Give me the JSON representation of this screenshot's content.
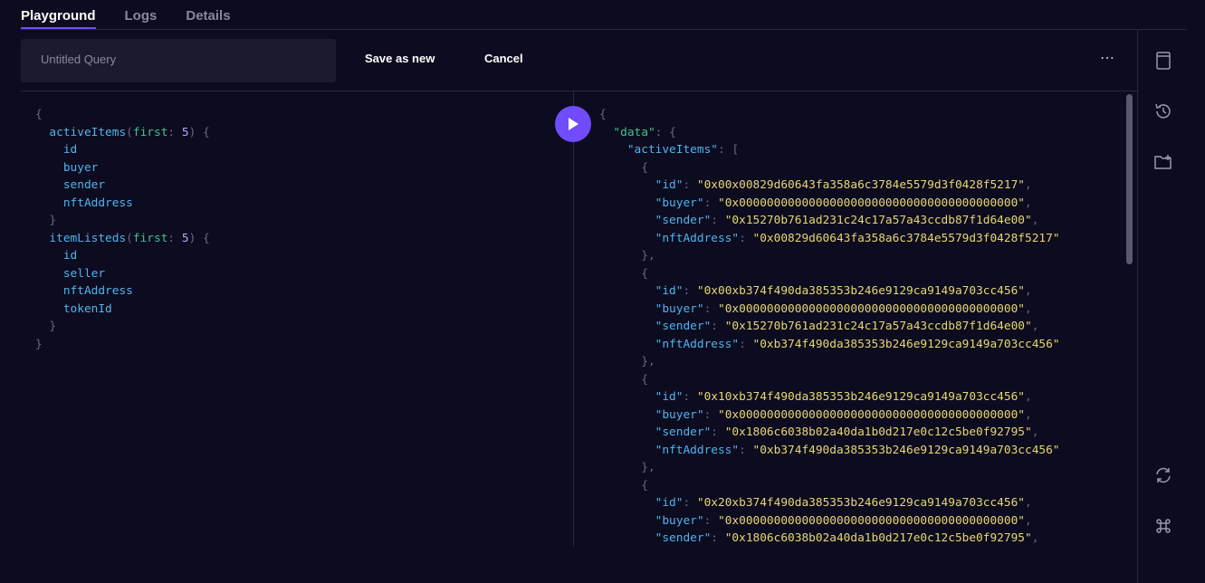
{
  "tabs": [
    {
      "label": "Playground"
    },
    {
      "label": "Logs"
    },
    {
      "label": "Details"
    }
  ],
  "toolbar": {
    "query_placeholder": "Untitled Query",
    "save_label": "Save as new",
    "cancel_label": "Cancel",
    "more_label": "⋯"
  },
  "query": {
    "open_brace": "{",
    "close_brace": "}",
    "entities": [
      {
        "name": "activeItems",
        "arg_name": "first",
        "arg_value": "5",
        "fields": [
          "id",
          "buyer",
          "sender",
          "nftAddress"
        ]
      },
      {
        "name": "itemListeds",
        "arg_name": "first",
        "arg_value": "5",
        "fields": [
          "id",
          "seller",
          "nftAddress",
          "tokenId"
        ]
      }
    ]
  },
  "result": {
    "data_key": "\"data\"",
    "collection_key": "\"activeItems\"",
    "items": [
      {
        "id": "0x00x00829d60643fa358a6c3784e5579d3f0428f5217",
        "buyer": "0x0000000000000000000000000000000000000000",
        "sender": "0x15270b761ad231c24c17a57a43ccdb87f1d64e00",
        "nftAddress": "0x00829d60643fa358a6c3784e5579d3f0428f5217"
      },
      {
        "id": "0x00xb374f490da385353b246e9129ca9149a703cc456",
        "buyer": "0x0000000000000000000000000000000000000000",
        "sender": "0x15270b761ad231c24c17a57a43ccdb87f1d64e00",
        "nftAddress": "0xb374f490da385353b246e9129ca9149a703cc456"
      },
      {
        "id": "0x10xb374f490da385353b246e9129ca9149a703cc456",
        "buyer": "0x0000000000000000000000000000000000000000",
        "sender": "0x1806c6038b02a40da1b0d217e0c12c5be0f92795",
        "nftAddress": "0xb374f490da385353b246e9129ca9149a703cc456"
      },
      {
        "id": "0x20xb374f490da385353b246e9129ca9149a703cc456",
        "buyer": "0x0000000000000000000000000000000000000000",
        "sender": "0x1806c6038b02a40da1b0d217e0c12c5be0f92795"
      }
    ]
  },
  "sidebar_icons": [
    "saved-queries-icon",
    "history-icon",
    "new-folder-icon",
    "refresh-icon",
    "command-icon"
  ],
  "colors": {
    "accent": "#6f4cff",
    "background": "#0d0b1f",
    "field": "#4ab6f0",
    "string": "#e6d86e",
    "arg": "#3ec28f"
  }
}
